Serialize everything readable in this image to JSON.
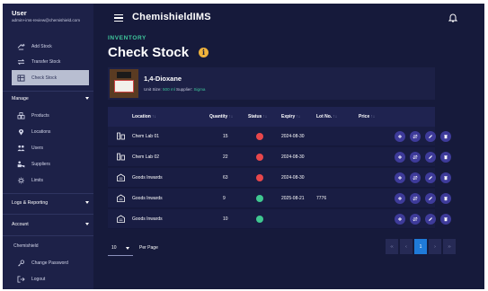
{
  "user": {
    "title": "User",
    "email": "admin+ims-review@chemishield.com"
  },
  "sidebar": {
    "stock_items": [
      {
        "label": "Add Stock",
        "icon": "add-stock-icon"
      },
      {
        "label": "Transfer Stock",
        "icon": "transfer-icon"
      },
      {
        "label": "Check Stock",
        "icon": "check-stock-icon",
        "active": true
      }
    ],
    "manage": {
      "label": "Manage",
      "items": [
        {
          "label": "Products",
          "icon": "products-icon"
        },
        {
          "label": "Locations",
          "icon": "location-pin-icon"
        },
        {
          "label": "Users",
          "icon": "users-icon"
        },
        {
          "label": "Suppliers",
          "icon": "suppliers-icon"
        },
        {
          "label": "Limits",
          "icon": "limits-icon"
        }
      ]
    },
    "logs": {
      "label": "Logs & Reporting"
    },
    "account": {
      "label": "Account"
    },
    "org": "Chemishield",
    "footer_items": [
      {
        "label": "Change Password",
        "icon": "key-icon"
      },
      {
        "label": "Logout",
        "icon": "logout-icon"
      }
    ]
  },
  "header": {
    "brand": "ChemishieldIMS"
  },
  "page": {
    "eyebrow": "INVENTORY",
    "title": "Check Stock",
    "info": "i"
  },
  "product": {
    "name": "1,4-Dioxane",
    "unit_size_label": "Unit Size:",
    "unit_size": "500 ml",
    "supplier_label": "Supplier:",
    "supplier": "Sigma"
  },
  "table": {
    "columns": [
      "Location",
      "Quantity",
      "Status",
      "Expiry",
      "Lot No.",
      "Price"
    ],
    "sort_glyph": "↑↓",
    "rows": [
      {
        "location": "Chem Lab 01",
        "type": "lab",
        "quantity": "15",
        "status": "red",
        "expiry": "2024-08-30",
        "lot": "",
        "price": ""
      },
      {
        "location": "Chem Lab 02",
        "type": "lab",
        "quantity": "22",
        "status": "red",
        "expiry": "2024-08-30",
        "lot": "",
        "price": ""
      },
      {
        "location": "Goods Inwards",
        "type": "store",
        "quantity": "63",
        "status": "red",
        "expiry": "2024-08-30",
        "lot": "",
        "price": ""
      },
      {
        "location": "Goods Inwards",
        "type": "store",
        "quantity": "9",
        "status": "green",
        "expiry": "2025-08-21",
        "lot": "7776",
        "price": ""
      },
      {
        "location": "Goods Inwards",
        "type": "store",
        "quantity": "10",
        "status": "green",
        "expiry": "",
        "lot": "",
        "price": ""
      }
    ],
    "actions": [
      "add",
      "transfer",
      "edit",
      "delete"
    ]
  },
  "pagination": {
    "per_page_value": "10",
    "per_page_label": "Per Page",
    "pages": [
      "‹‹",
      "‹",
      "1",
      "›",
      "››"
    ],
    "current": "1"
  },
  "colors": {
    "status_red": "#e8474b",
    "status_green": "#3fc790",
    "accent": "#3fc79c",
    "page_active": "#1f7ad8"
  }
}
